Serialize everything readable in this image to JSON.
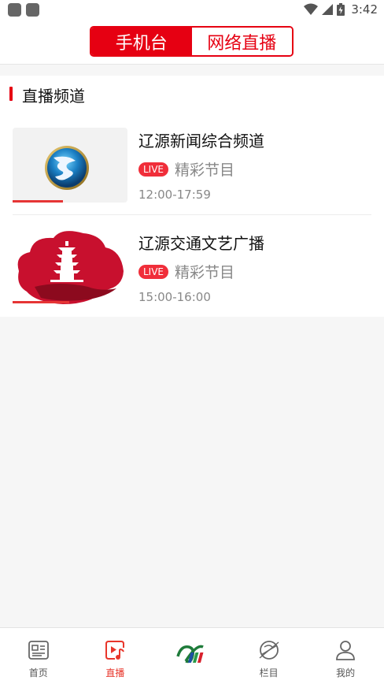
{
  "status_bar": {
    "time": "3:42"
  },
  "top_tabs": [
    {
      "label": "手机台",
      "active": true
    },
    {
      "label": "网络直播",
      "active": false
    }
  ],
  "section": {
    "title": "直播频道"
  },
  "channels": [
    {
      "name": "辽源新闻综合频道",
      "badge": "LIVE",
      "program": "精彩节目",
      "time": "12:00-17:59",
      "logo_icon": "globe-logo-icon",
      "progress": 0.44
    },
    {
      "name": "辽源交通文艺广播",
      "badge": "LIVE",
      "program": "精彩节目",
      "time": "15:00-16:00",
      "logo_icon": "pagoda-logo-icon",
      "progress": 0.49
    }
  ],
  "bottom_nav": [
    {
      "label": "首页",
      "icon": "newspaper-icon",
      "active": false
    },
    {
      "label": "直播",
      "icon": "live-video-icon",
      "active": true
    },
    {
      "label": "",
      "icon": "station-logo-icon",
      "active": false
    },
    {
      "label": "栏目",
      "icon": "planet-icon",
      "active": false
    },
    {
      "label": "我的",
      "icon": "user-icon",
      "active": false
    }
  ],
  "colors": {
    "accent": "#e60012",
    "live_badge": "#f02e3a",
    "nav_active": "#e8362b"
  }
}
